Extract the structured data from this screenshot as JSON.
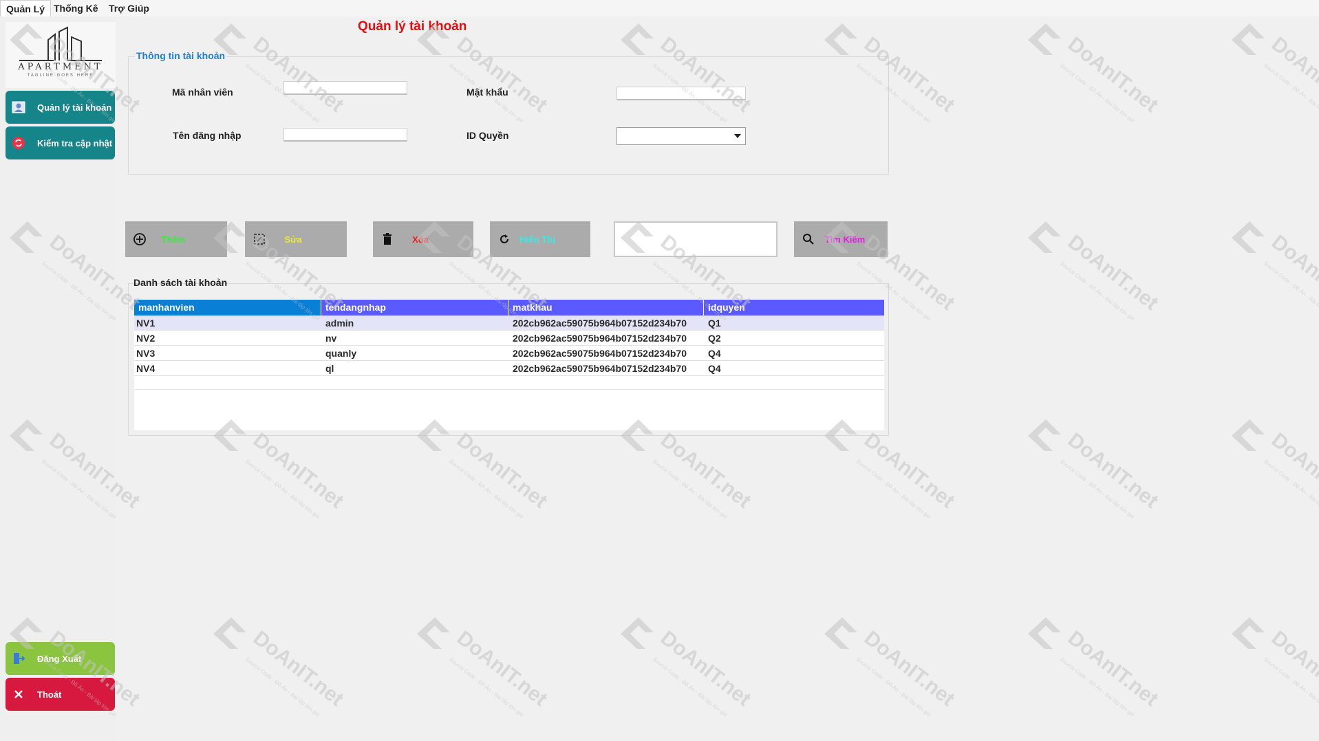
{
  "menu": {
    "items": [
      "Quản Lý",
      "Thống Kê",
      "Trợ Giúp"
    ]
  },
  "logo": {
    "text": "APARTMENT",
    "tagline": "TAGLINE GOES HERE"
  },
  "sidebar": {
    "account_btn": "Quản lý tài khoản",
    "update_btn": "Kiểm tra cập nhật",
    "logout_btn": "Đăng Xuất",
    "exit_btn": "Thoát"
  },
  "page": {
    "title": "Quản lý tài khoản"
  },
  "info": {
    "legend": "Thông tin tài khoản",
    "employee_id_label": "Mã nhân viên",
    "employee_id_value": "",
    "password_label": "Mật khẩu",
    "password_value": "",
    "username_label": "Tên đăng nhập",
    "username_value": "",
    "role_label": "ID Quyền",
    "role_value": ""
  },
  "actions": {
    "add": "Thêm",
    "edit": "Sửa",
    "delete": "Xóa",
    "show": "Hiển Thị",
    "search_value": "",
    "search": "Tìm Kiếm"
  },
  "list": {
    "legend": "Danh sách tài khoản",
    "columns": [
      "manhanvien",
      "tendangnhap",
      "matkhau",
      "idquyen"
    ],
    "rows": [
      [
        "NV1",
        "admin",
        "202cb962ac59075b964b07152d234b70",
        "Q1"
      ],
      [
        "NV2",
        "nv",
        "202cb962ac59075b964b07152d234b70",
        "Q2"
      ],
      [
        "NV3",
        "quanly",
        "202cb962ac59075b964b07152d234b70",
        "Q4"
      ],
      [
        "NV4",
        "ql",
        "202cb962ac59075b964b07152d234b70",
        "Q4"
      ]
    ]
  },
  "watermark": {
    "brand": "DoAnIT.net",
    "sub": "Source Code - Đồ Án - Bài tập lớn giá rẻ"
  },
  "colors": {
    "title": "#e01010",
    "teal": "#16858a",
    "green": "#8bc53f",
    "red": "#d7193f",
    "grid_header": "#5a5aff",
    "add_text": "#3ee83e",
    "edit_text": "#e8e83e",
    "delete_text": "#e82020",
    "show_text": "#3ee8e8",
    "search_text": "#e020e0"
  }
}
